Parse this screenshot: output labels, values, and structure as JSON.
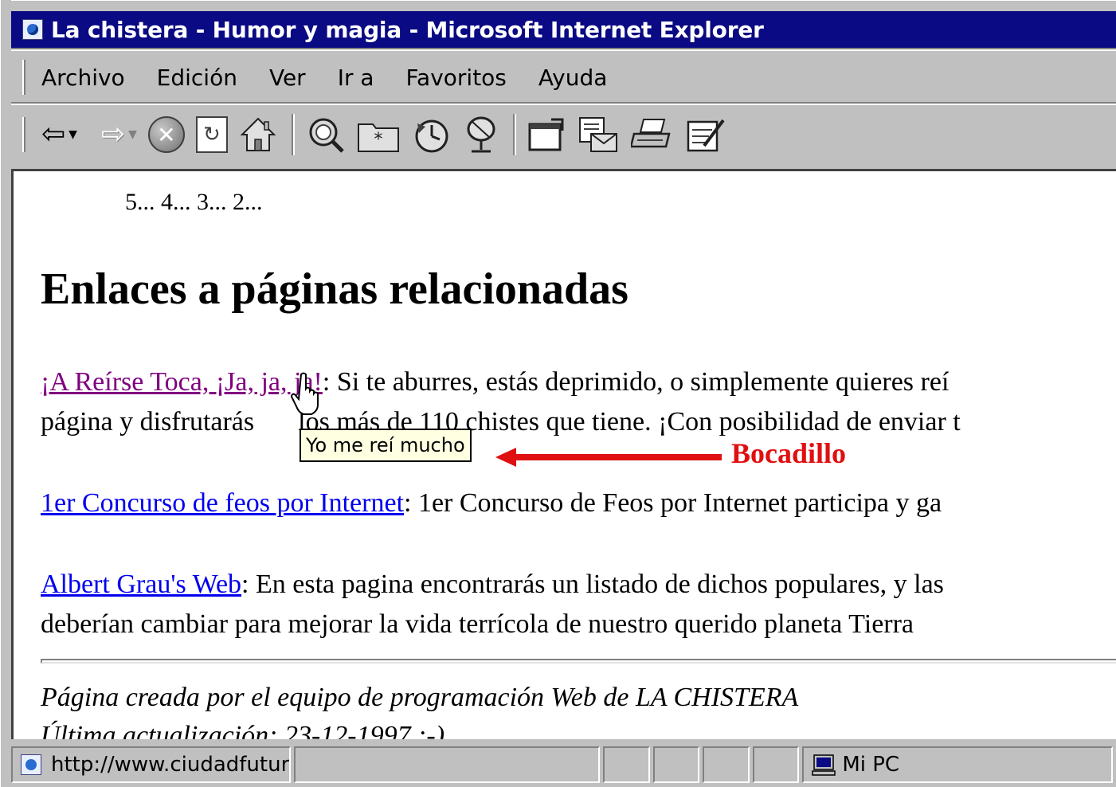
{
  "window": {
    "title": "La chistera - Humor y magia - Microsoft Internet Explorer"
  },
  "menu": {
    "items": [
      {
        "label": "Archivo"
      },
      {
        "label": "Edición"
      },
      {
        "label": "Ver"
      },
      {
        "label": "Ir a"
      },
      {
        "label": "Favoritos"
      },
      {
        "label": "Ayuda"
      }
    ]
  },
  "toolbar": {
    "buttons": [
      "back-icon",
      "forward-icon",
      "stop-icon",
      "refresh-icon",
      "home-icon",
      "search-icon",
      "favorites-icon",
      "history-icon",
      "channels-icon",
      "fullscreen-icon",
      "mail-icon",
      "print-icon",
      "edit-icon"
    ]
  },
  "page": {
    "countdown": "5... 4... 3... 2...",
    "heading": "Enlaces a páginas relacionadas",
    "links": [
      {
        "link_text": "¡A Reírse Toca, ¡Ja, ja, ja!",
        "line1": ": Si te aburres, estás deprimido, o simplemente quieres reí",
        "line2": "página y disfrutarás ",
        "line2_b": " los más de 110 chistes que tiene. ¡Con posibilidad de enviar t"
      },
      {
        "link_text": "1er Concurso de feos por Internet",
        "line1": ": 1er Concurso de Feos por Internet participa y ga"
      },
      {
        "link_text": "Albert Grau's Web",
        "line1": ": En esta pagina encontrarás un listado de dichos populares, y las",
        "line2": "deberían cambiar para mejorar la vida terrícola de nuestro querido planeta Tierra"
      }
    ],
    "footer": "Página creada por el equipo de programación Web de LA CHISTERA",
    "footer_partial": "Última actualización: 23-12-1997 :-)"
  },
  "tooltip": {
    "text": "Yo me reí mucho"
  },
  "annotation": {
    "label": "Bocadillo",
    "color": "#e01010"
  },
  "statusbar": {
    "url": "http://www.ciudadfutur",
    "zone": "Mi PC"
  }
}
